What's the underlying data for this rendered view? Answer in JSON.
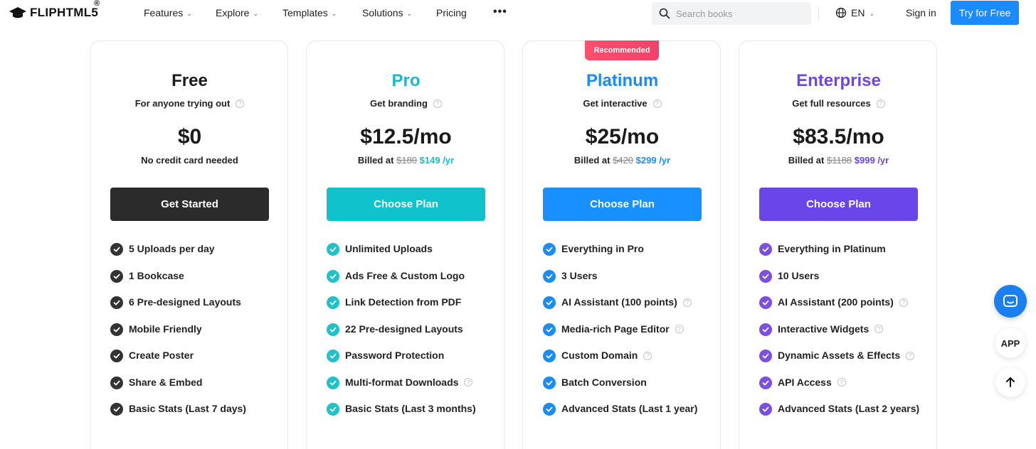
{
  "nav": {
    "logo_text": "FLIPHTML5",
    "logo_reg": "®",
    "menu": [
      {
        "label": "Features",
        "has_dropdown": true
      },
      {
        "label": "Explore",
        "has_dropdown": true
      },
      {
        "label": "Templates",
        "has_dropdown": true
      },
      {
        "label": "Solutions",
        "has_dropdown": true
      },
      {
        "label": "Pricing",
        "has_dropdown": false
      }
    ],
    "more_label": "•••",
    "search_placeholder": "Search books",
    "lang": "EN",
    "sign_in": "Sign in",
    "try_free": "Try for Free",
    "accent": "#1a8cff"
  },
  "badge": "Recommended",
  "plans": [
    {
      "name": "Free",
      "name_color": "#1a1a1a",
      "subtitle": "For anyone trying out",
      "price": "$0",
      "note": "No credit card needed",
      "cta": "Get Started",
      "cta_color": "#2b2b2b",
      "check_color": "#333333",
      "features": [
        {
          "text": "5 Uploads per day",
          "help": false
        },
        {
          "text": "1 Bookcase",
          "help": false
        },
        {
          "text": "6 Pre-designed Layouts",
          "help": false
        },
        {
          "text": "Mobile Friendly",
          "help": false
        },
        {
          "text": "Create Poster",
          "help": false
        },
        {
          "text": "Share & Embed",
          "help": false
        },
        {
          "text": "Basic Stats (Last 7 days)",
          "help": false
        }
      ]
    },
    {
      "name": "Pro",
      "name_color": "#1ab7cf",
      "subtitle": "Get branding",
      "price": "$12.5/mo",
      "billed_prefix": "Billed at",
      "billed_old": "$180",
      "billed_new": "$149 /yr",
      "cta": "Choose Plan",
      "cta_color": "#0fc2cc",
      "check_color": "#1fc2c9",
      "features": [
        {
          "text": "Unlimited Uploads",
          "help": false
        },
        {
          "text": "Ads Free & Custom Logo",
          "help": false
        },
        {
          "text": "Link Detection from PDF",
          "help": false
        },
        {
          "text": "22 Pre-designed Layouts",
          "help": false
        },
        {
          "text": "Password Protection",
          "help": false
        },
        {
          "text": "Multi-format Downloads",
          "help": true
        },
        {
          "text": "Basic Stats (Last 3 months)",
          "help": false
        }
      ]
    },
    {
      "name": "Platinum",
      "name_color": "#1a8cf5",
      "subtitle": "Get interactive",
      "price": "$25/mo",
      "billed_prefix": "Billed at",
      "billed_old": "$420",
      "billed_new": "$299 /yr",
      "cta": "Choose Plan",
      "cta_color": "#1890ff",
      "check_color": "#1a8cf5",
      "features": [
        {
          "text": "Everything in Pro",
          "help": false
        },
        {
          "text": "3 Users",
          "help": false
        },
        {
          "text": "AI Assistant (100 points)",
          "help": true
        },
        {
          "text": "Media-rich Page Editor",
          "help": true
        },
        {
          "text": "Custom Domain",
          "help": true
        },
        {
          "text": "Batch Conversion",
          "help": false
        },
        {
          "text": "Advanced Stats (Last 1 year)",
          "help": false
        }
      ]
    },
    {
      "name": "Enterprise",
      "name_color": "#6d45e8",
      "subtitle": "Get full resources",
      "price": "$83.5/mo",
      "billed_prefix": "Billed at",
      "billed_old": "$1188",
      "billed_new": "$999 /yr",
      "cta": "Choose Plan",
      "cta_color": "#6a46ea",
      "check_color": "#7b4fe0",
      "features": [
        {
          "text": "Everything in Platinum",
          "help": false
        },
        {
          "text": "10 Users",
          "help": false
        },
        {
          "text": "AI Assistant (200 points)",
          "help": true
        },
        {
          "text": "Interactive Widgets",
          "help": true
        },
        {
          "text": "Dynamic Assets & Effects",
          "help": true
        },
        {
          "text": "API Access",
          "help": true
        },
        {
          "text": "Advanced Stats (Last 2 years)",
          "help": false
        }
      ]
    }
  ],
  "floating": {
    "app_label": "APP"
  }
}
